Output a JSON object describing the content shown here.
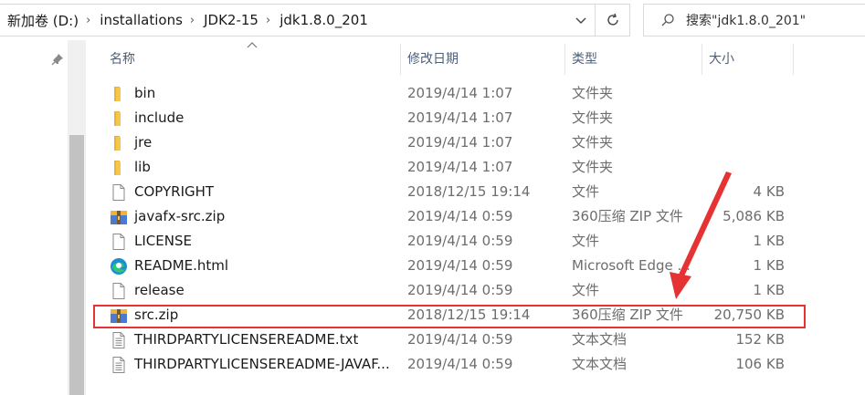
{
  "address_bar": {
    "crumbs": [
      "新加卷 (D:)",
      "installations",
      "JDK2-15",
      "jdk1.8.0_201"
    ],
    "separator": "›",
    "dropdown_icon": "chevron-down-icon",
    "refresh_icon": "refresh-icon"
  },
  "search": {
    "placeholder": "搜索\"jdk1.8.0_201\"",
    "icon": "search-icon"
  },
  "columns": {
    "name": "名称",
    "date": "修改日期",
    "type": "类型",
    "size": "大小"
  },
  "rows": [
    {
      "icon": "folder-icon",
      "name": "bin",
      "date": "2019/4/14 1:07",
      "type": "文件夹",
      "size": ""
    },
    {
      "icon": "folder-icon",
      "name": "include",
      "date": "2019/4/14 1:07",
      "type": "文件夹",
      "size": ""
    },
    {
      "icon": "folder-icon",
      "name": "jre",
      "date": "2019/4/14 1:07",
      "type": "文件夹",
      "size": ""
    },
    {
      "icon": "folder-icon",
      "name": "lib",
      "date": "2019/4/14 1:07",
      "type": "文件夹",
      "size": ""
    },
    {
      "icon": "file-icon",
      "name": "COPYRIGHT",
      "date": "2018/12/15 19:14",
      "type": "文件",
      "size": "4 KB"
    },
    {
      "icon": "zip-archive-icon",
      "name": "javafx-src.zip",
      "date": "2019/4/14 0:59",
      "type": "360压缩 ZIP 文件",
      "size": "5,086 KB"
    },
    {
      "icon": "file-icon",
      "name": "LICENSE",
      "date": "2019/4/14 0:59",
      "type": "文件",
      "size": "1 KB"
    },
    {
      "icon": "edge-browser-icon",
      "name": "README.html",
      "date": "2019/4/14 0:59",
      "type": "Microsoft Edge ...",
      "size": "1 KB"
    },
    {
      "icon": "file-icon",
      "name": "release",
      "date": "2019/4/14 0:59",
      "type": "文件",
      "size": "1 KB"
    },
    {
      "icon": "zip-archive-icon",
      "name": "src.zip",
      "date": "2018/12/15 19:14",
      "type": "360压缩 ZIP 文件",
      "size": "20,750 KB"
    },
    {
      "icon": "text-document-icon",
      "name": "THIRDPARTYLICENSEREADME.txt",
      "date": "2019/4/14 0:59",
      "type": "文本文档",
      "size": "152 KB"
    },
    {
      "icon": "text-document-icon",
      "name": "THIRDPARTYLICENSEREADME-JAVAF...",
      "date": "2019/4/14 0:59",
      "type": "文本文档",
      "size": "106 KB"
    }
  ],
  "annotation": {
    "highlighted_row": "src.zip",
    "color": "#e53333"
  },
  "colors": {
    "folder": "#f4c64b",
    "header_text": "#4c607a",
    "secondary_text": "#6d6d6d"
  }
}
